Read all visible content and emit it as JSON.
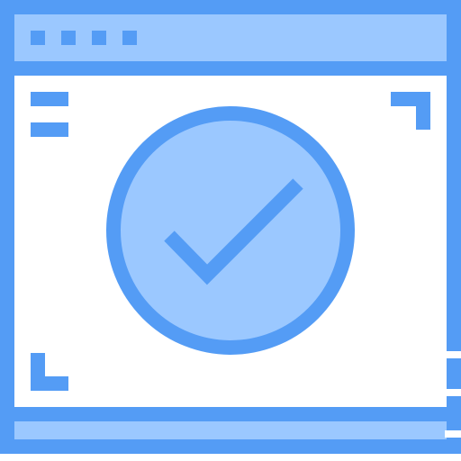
{
  "icon": {
    "name": "browser-window-check-icon",
    "colors": {
      "stroke": "#549cf5",
      "fill_light": "#9bc8ff",
      "background": "#ffffff"
    },
    "titlebar_dots": 4,
    "status": "checked"
  }
}
